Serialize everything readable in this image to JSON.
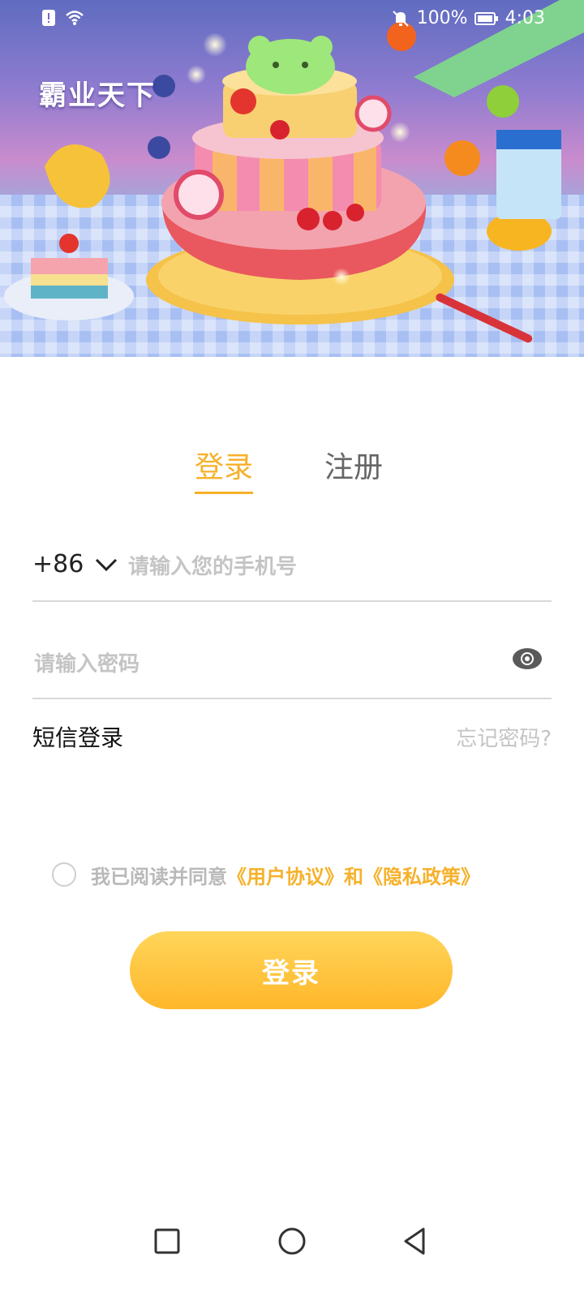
{
  "status_bar": {
    "battery": "100%",
    "time": "4:03"
  },
  "banner": {
    "app_name": "霸业天下"
  },
  "tabs": {
    "login": "登录",
    "register": "注册"
  },
  "form": {
    "country_code": "+86",
    "phone_placeholder": "请输入您的手机号",
    "password_placeholder": "请输入密码",
    "sms_login": "短信登录",
    "forgot_password": "忘记密码?"
  },
  "agreement": {
    "prefix": "我已阅读并同意",
    "user_agreement": "《用户协议》",
    "and": "和",
    "privacy_policy": "《隐私政策》"
  },
  "login_button": "登录",
  "colors": {
    "accent": "#f6b12a",
    "button_top": "#ffd55a",
    "button_bottom": "#ffb72a",
    "placeholder": "#c4c4c4"
  },
  "icons": [
    "notification-icon",
    "wifi-icon",
    "mute-icon",
    "battery-icon",
    "chevron-down-icon",
    "eye-icon",
    "recent-apps-icon",
    "home-icon",
    "back-icon"
  ]
}
